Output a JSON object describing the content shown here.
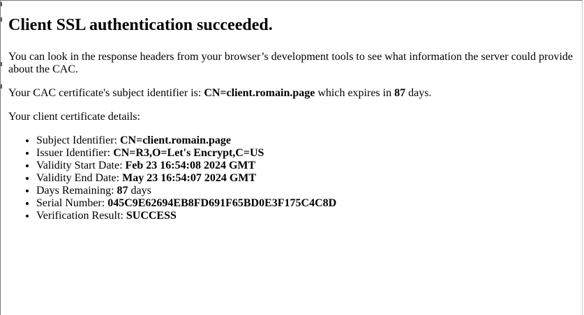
{
  "page": {
    "heading": "Client SSL authentication succeeded.",
    "intro": "You can look in the response headers from your browser’s development tools to see what information the server could provide about the CAC.",
    "subject_sentence": {
      "prefix": "Your CAC certificate's subject identifier is: ",
      "subject": "CN=client.romain.page",
      "middle": " which expires in ",
      "days": "87",
      "suffix": " days."
    },
    "details_label": "Your client certificate details:",
    "details": [
      {
        "label": "Subject Identifier: ",
        "value": "CN=client.romain.page",
        "suffix": ""
      },
      {
        "label": "Issuer Identifier: ",
        "value": "CN=R3,O=Let's Encrypt,C=US",
        "suffix": ""
      },
      {
        "label": "Validity Start Date: ",
        "value": "Feb 23 16:54:08 2024 GMT",
        "suffix": ""
      },
      {
        "label": "Validity End Date: ",
        "value": "May 23 16:54:07 2024 GMT",
        "suffix": ""
      },
      {
        "label": "Days Remaining: ",
        "value": "87",
        "suffix": " days"
      },
      {
        "label": "Serial Number: ",
        "value": "045C9E62694EB8FD691F65BD0E3F175C4C8D",
        "suffix": ""
      },
      {
        "label": "Verification Result: ",
        "value": "SUCCESS",
        "suffix": ""
      }
    ]
  }
}
